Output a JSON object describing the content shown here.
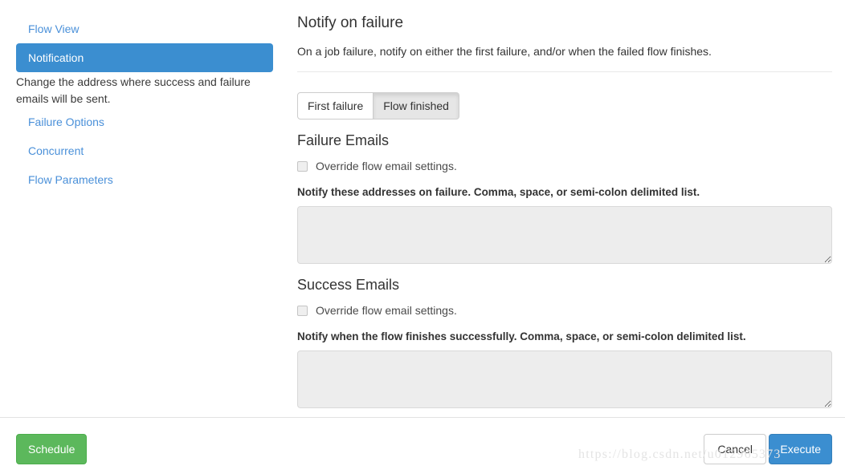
{
  "sidebar": {
    "items": [
      {
        "label": "Flow View",
        "active": false
      },
      {
        "label": "Notification",
        "active": true
      },
      {
        "label": "Failure Options",
        "active": false
      },
      {
        "label": "Concurrent",
        "active": false
      },
      {
        "label": "Flow Parameters",
        "active": false
      }
    ],
    "active_description": "Change the address where success and failure emails will be sent."
  },
  "main": {
    "title": "Notify on failure",
    "subtitle": "On a job failure, notify on either the first failure, and/or when the failed flow finishes.",
    "toggle_group": {
      "options": [
        {
          "label": "First failure",
          "pressed": false
        },
        {
          "label": "Flow finished",
          "pressed": true
        }
      ]
    },
    "failure_section": {
      "heading": "Failure Emails",
      "override_label": "Override flow email settings.",
      "override_checked": false,
      "field_label": "Notify these addresses on failure. Comma, space, or semi-colon delimited list.",
      "textarea_value": "",
      "textarea_placeholder": ""
    },
    "success_section": {
      "heading": "Success Emails",
      "override_label": "Override flow email settings.",
      "override_checked": false,
      "field_label": "Notify when the flow finishes successfully. Comma, space, or semi-colon delimited list.",
      "textarea_value": "",
      "textarea_placeholder": ""
    }
  },
  "footer": {
    "schedule_label": "Schedule",
    "cancel_label": "Cancel",
    "execute_label": "Execute"
  },
  "watermark": {
    "text": "https://blog.csdn.net/u012965373"
  },
  "colors": {
    "accent_blue": "#3b8ed0",
    "link_blue": "#4a90d9",
    "success_green": "#5cb85c",
    "panel_border": "#e2e2e2",
    "input_bg": "#ededed"
  }
}
